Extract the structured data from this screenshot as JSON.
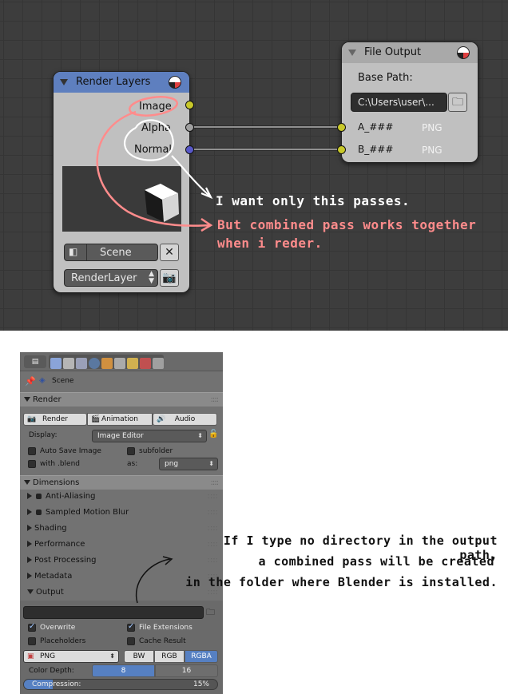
{
  "node_editor": {
    "render_layers": {
      "title": "Render Layers",
      "sockets": [
        "Image",
        "Alpha",
        "Normal"
      ],
      "scene": "Scene",
      "render_layer": "RenderLayer"
    },
    "file_output": {
      "title": "File Output",
      "base_path_label": "Base Path:",
      "base_path_value": "C:\\Users\\user\\...",
      "inputs": [
        {
          "name": "A_###",
          "format": "PNG"
        },
        {
          "name": "B_###",
          "format": "PNG"
        }
      ]
    },
    "annotations": {
      "note1": "I want only this passes.",
      "note2_line1": "But combined pass works together",
      "note2_line2": "when i reder."
    },
    "colors": {
      "render_layers_header": "#5e7fbf",
      "socket_yellow": "#c8c82a",
      "socket_grey": "#a0a0a0",
      "socket_blue": "#5858c8",
      "annotation_pink": "#ff8c8c"
    }
  },
  "properties": {
    "context": "Scene",
    "render": {
      "header": "Render",
      "buttons": [
        "Render",
        "Animation",
        "Audio"
      ],
      "display_label": "Display:",
      "display_value": "Image Editor",
      "auto_save": "Auto Save Image",
      "subfolder": "subfolder",
      "with_blend": "with .blend",
      "as_label": "as:",
      "as_value": "png"
    },
    "sections": [
      {
        "label": "Dimensions",
        "expanded": true
      },
      {
        "label": "Anti-Aliasing",
        "has_toggle": true
      },
      {
        "label": "Sampled Motion Blur",
        "has_toggle": true
      },
      {
        "label": "Shading"
      },
      {
        "label": "Performance"
      },
      {
        "label": "Post Processing"
      },
      {
        "label": "Metadata"
      },
      {
        "label": "Output",
        "expanded": true
      }
    ],
    "output": {
      "path": "",
      "overwrite": "Overwrite",
      "file_extensions": "File Extensions",
      "placeholders": "Placeholders",
      "cache_result": "Cache Result",
      "format": "PNG",
      "color_modes": [
        "BW",
        "RGB",
        "RGBA"
      ],
      "active_color_mode": "RGBA",
      "color_depth_label": "Color Depth:",
      "color_depths": [
        "8",
        "16"
      ],
      "active_color_depth": "8",
      "compression_label": "Compression:",
      "compression_value": "15%",
      "compression_fraction": 0.15
    }
  },
  "side_annotation": {
    "line1": "If I type no directory in the output path,",
    "line2": "a combined pass will be created",
    "line3": "in the folder where Blender is installed."
  }
}
